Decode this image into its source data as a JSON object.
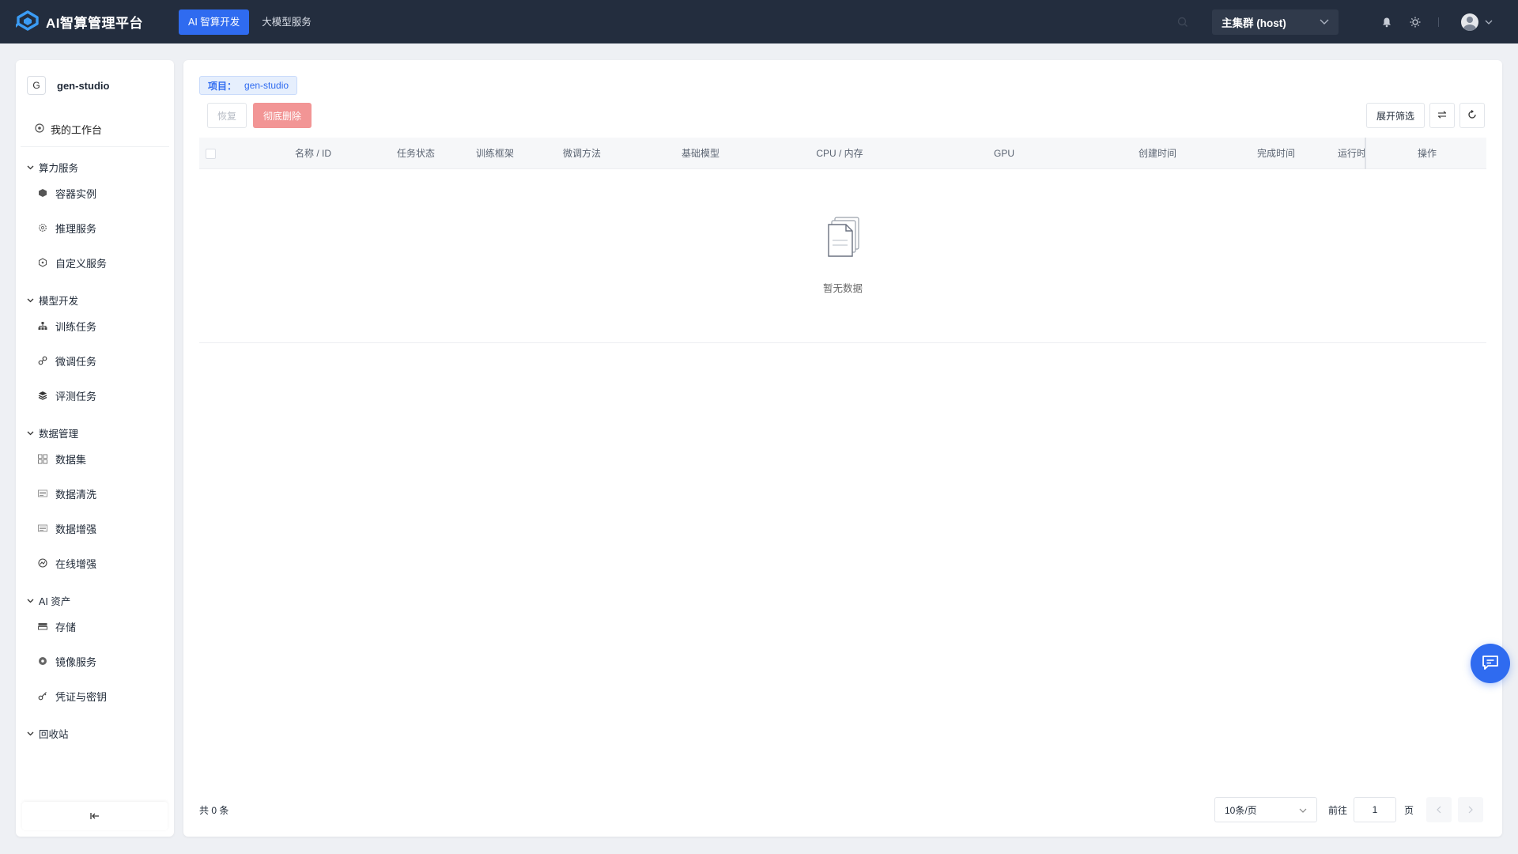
{
  "app": {
    "title": "AI智算管理平台",
    "logo_icon": "brand-logo-icon",
    "colors": {
      "topbar": "#232d3e",
      "accent": "#2f6bf0",
      "danger_disabled": "#f29595"
    }
  },
  "topnav": [
    {
      "label": "AI 智算开发",
      "active": true
    },
    {
      "label": "大模型服务",
      "active": false
    }
  ],
  "header": {
    "cluster": "主集群 (host)",
    "icons": [
      "search-icon",
      "bell-icon",
      "sun-icon",
      "avatar"
    ]
  },
  "sidebar": {
    "project_badge": "G",
    "project_name": "gen-studio",
    "workbench": "我的工作台",
    "groups": [
      {
        "title": "算力服务",
        "items": [
          "容器实例",
          "推理服务",
          "自定义服务"
        ]
      },
      {
        "title": "模型开发",
        "items": [
          "训练任务",
          "微调任务",
          "评测任务"
        ]
      },
      {
        "title": "数据管理",
        "items": [
          "数据集",
          "数据清洗",
          "数据增强",
          "在线增强"
        ]
      },
      {
        "title": "AI 资产",
        "items": [
          "存储",
          "镜像服务",
          "凭证与密钥"
        ]
      },
      {
        "title": "回收站",
        "items": []
      }
    ]
  },
  "main": {
    "project_tag": {
      "key": "项目：",
      "value": "gen-studio"
    },
    "toolbar": {
      "restore": "恢复",
      "purge": "彻底删除",
      "filter": "展开筛选"
    },
    "columns": [
      "名称 / ID",
      "任务状态",
      "训练框架",
      "微调方法",
      "基础模型",
      "CPU / 内存",
      "GPU",
      "创建时间",
      "完成时间",
      "运行时",
      "操作"
    ],
    "empty_text": "暂无数据",
    "pagination": {
      "total": "共 0 条",
      "page_size": "10条/页",
      "goto_label": "前往",
      "current_page": "1",
      "page_suffix": "页"
    }
  }
}
